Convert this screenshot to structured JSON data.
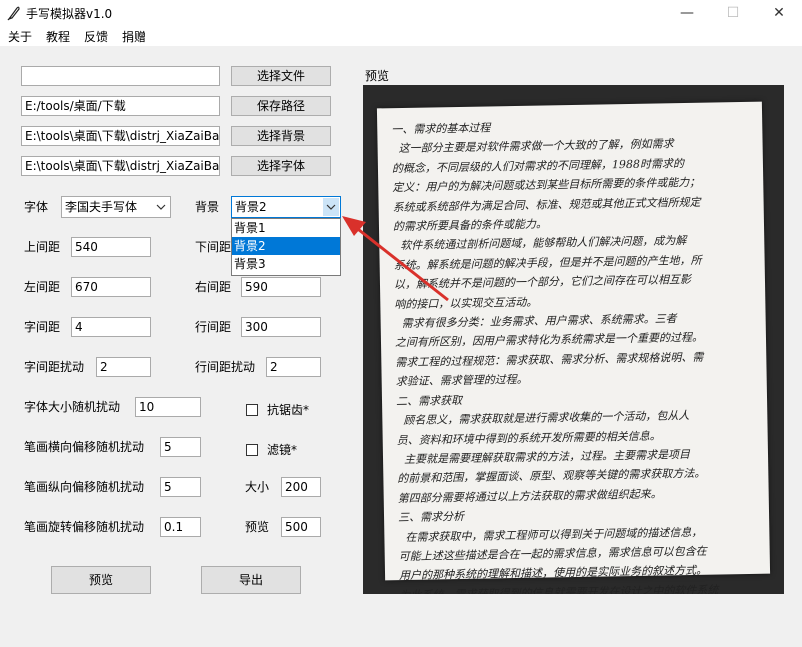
{
  "window": {
    "title": "手写模拟器v1.0",
    "minimize": "—",
    "maximize": "☐",
    "close": "✕"
  },
  "menu": [
    "关于",
    "教程",
    "反馈",
    "捐赠"
  ],
  "files": {
    "text_file_value": "",
    "select_file": "选择文件",
    "save_path_value": "E:/tools/桌面/下载",
    "save_path_button": "保存路径",
    "background_value": "E:\\tools\\桌面\\下载\\distrj_XiaZaiBa\\",
    "select_background": "选择背景",
    "font_value": "E:\\tools\\桌面\\下载\\distrj_XiaZaiBa\\",
    "select_font": "选择字体"
  },
  "font": {
    "label": "字体",
    "value": "李国夫手写体"
  },
  "background": {
    "label": "背景",
    "value": "背景2",
    "options": [
      "背景1",
      "背景2",
      "背景3"
    ],
    "selected_index": 1
  },
  "params": {
    "top_margin_label": "上间距",
    "top_margin": "540",
    "bottom_margin_label": "下间距",
    "left_margin_label": "左间距",
    "left_margin": "670",
    "right_margin_label": "右间距",
    "right_margin": "590",
    "char_spacing_label": "字间距",
    "char_spacing": "4",
    "line_spacing_label": "行间距",
    "line_spacing": "300",
    "char_spacing_jitter_label": "字间距扰动",
    "char_spacing_jitter": "2",
    "line_spacing_jitter_label": "行间距扰动",
    "line_spacing_jitter": "2",
    "font_size_jitter_label": "字体大小随机扰动",
    "font_size_jitter": "10",
    "antialias_label": "抗锯齿*",
    "h_offset_label": "笔画横向偏移随机扰动",
    "h_offset": "5",
    "filter_label": "滤镜*",
    "v_offset_label": "笔画纵向偏移随机扰动",
    "v_offset": "5",
    "size_label": "大小",
    "size": "200",
    "rotation_label": "笔画旋转偏移随机扰动",
    "rotation": "0.1",
    "preview_size_label": "预览",
    "preview_size": "500"
  },
  "buttons": {
    "preview": "预览",
    "export": "导出"
  },
  "preview_panel": {
    "title": "预览",
    "handwriting": "一、需求的基本过程\n  这一部分主要是对软件需求做一个大致的了解，例如需求\n的概念，不同层级的人们对需求的不同理解，1988时需求的\n定义：用户的为解决问题或达到某些目标所需要的条件或能力；\n系统或系统部件为满足合同、标准、规范或其他正式文档所规定\n的需求所要具备的条件或能力。\n  软件系统通过剖析问题域，能够帮助人们解决问题，成为解\n系统。解系统是问题的解决手段，但是并不是问题的产生地，所\n以，解系统并不是问题的一个部分，它们之间存在可以相互影\n响的接口，以实现交互活动。\n  需求有很多分类：业务需求、用户需求、系统需求。三者\n之间有所区别，因用户需求特化为系统需求是一个重要的过程。\n需求工程的过程规范：需求获取、需求分析、需求规格说明、需\n求验证、需求管理的过程。\n二、需求获取\n  顾名思义，需求获取就是进行需求收集的一个活动，包从人\n员、资料和环境中得到的系统开发所需要的相关信息。\n  主要就是需要理解获取需求的方法，过程。主要需求是项目\n的前景和范围，掌握面谈、原型、观察等关键的需求获取方法。\n第四部分需要将通过以上方法获取的需求做组织起来。\n三、需求分析\n  在需求获取中，需求工程师可以得到关于问题域的描述信息，\n可能上述这些描述是合在一起的需求信息，需求信息可以包含在\n用户的那种系统的理解和描述，使用的是实际业务的叙述方式。\n为此系统，需求获取得到的信息就需要开发在设计之中的软件系统\n解决方案之间有着很大的差距，因此需求分析就做了这一差距\n的需求工程活动。"
  },
  "colors": {
    "accent": "#0078d7",
    "arrow": "#d9312b"
  }
}
